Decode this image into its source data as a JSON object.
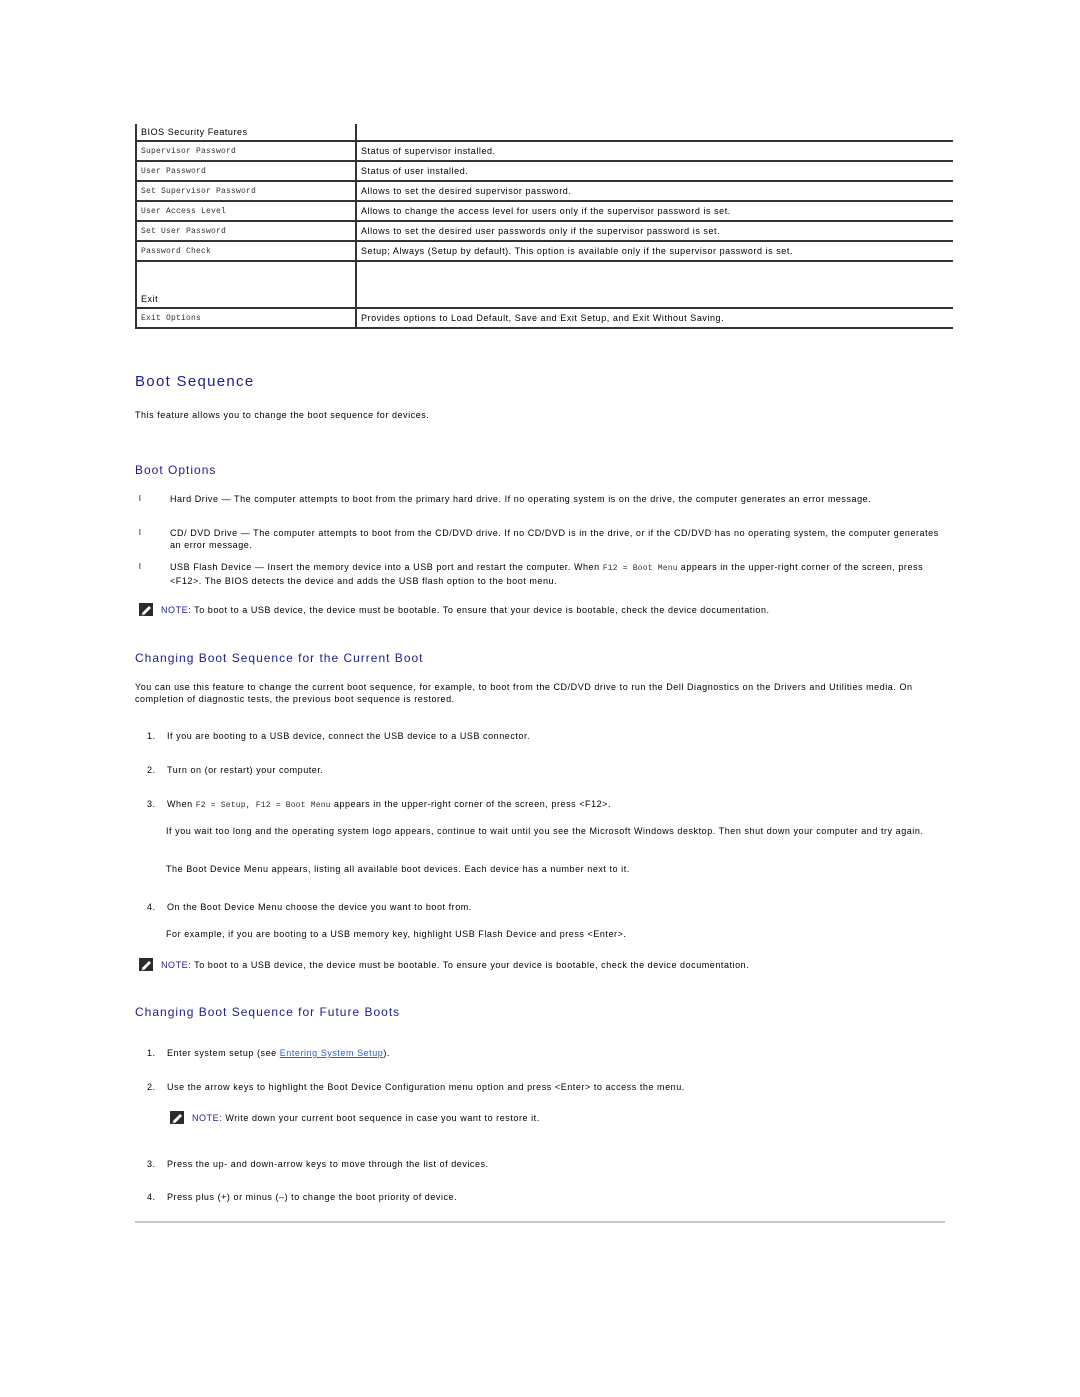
{
  "table": {
    "header": "BIOS Security Features",
    "rows": [
      {
        "option": "Supervisor Password",
        "desc": "Status of supervisor installed."
      },
      {
        "option": "User Password",
        "desc": "Status of user installed."
      },
      {
        "option": "Set Supervisor Password",
        "desc": "Allows to set the desired supervisor password."
      },
      {
        "option": "User Access Level",
        "desc": "Allows to change the access level for users only if the supervisor password is set."
      },
      {
        "option": "Set User Password",
        "desc": "Allows to set the desired user passwords only if the supervisor password is set."
      },
      {
        "option": "Password Check",
        "desc": "Setup; Always (Setup by default). This option is available only if the supervisor password is set."
      }
    ],
    "group2_header": "Exit",
    "group2_rows": [
      {
        "option": "Exit Options",
        "desc": "Provides options to Load Default, Save and Exit Setup, and Exit Without Saving."
      }
    ]
  },
  "boot_sequence": {
    "title": "Boot Sequence",
    "intro": "This feature allows you to change the boot sequence for devices."
  },
  "boot_options": {
    "title": "Boot Options",
    "bullet_mark": "l",
    "items": [
      {
        "name": "Hard Drive",
        "dash": " — ",
        "text": "The computer attempts to boot from the primary hard drive. If no operating system is on the drive, the computer generates an error message."
      },
      {
        "name": "CD/ DVD Drive",
        "dash": " — ",
        "text": "The computer attempts to boot from the CD/DVD drive. If no CD/DVD is in the drive, or if the CD/DVD has no operating system, the computer generates an error message."
      },
      {
        "name": "USB Flash Device",
        "dash": " — ",
        "text_before": "Insert the memory device into a USB port and restart the computer. When ",
        "code": "F12 = Boot Menu",
        "text_after": " appears in the upper-right corner of the screen, press <F12>. The BIOS detects the device and adds the USB flash option to the boot menu."
      }
    ],
    "note_label": "NOTE:",
    "note_text": " To boot to a USB device, the device must be bootable. To ensure that your device is bootable, check the device documentation."
  },
  "current_boot": {
    "title": "Changing Boot Sequence for the Current Boot",
    "intro": "You can use this feature to change the current boot sequence, for example, to boot from the CD/DVD drive to run the Dell Diagnostics on the Drivers and Utilities media. On completion of diagnostic tests, the previous boot sequence is restored.",
    "steps": [
      {
        "num": "1.",
        "text": "If you are booting to a USB device, connect the USB device to a USB connector."
      },
      {
        "num": "2.",
        "text": "Turn on (or restart) your computer."
      },
      {
        "num": "3.",
        "text_before": "When ",
        "code": "F2 = Setup, F12 = Boot Menu",
        "text_after": " appears in the upper-right corner of the screen, press <F12>."
      },
      {
        "num": "4.",
        "text": "On the Boot Device Menu choose the device you want to boot from."
      }
    ],
    "step3_sub1": "If you wait too long and the operating system logo appears, continue to wait until you see the Microsoft Windows desktop. Then shut down your computer and try again.",
    "step3_sub2": "The Boot Device Menu appears, listing all available boot devices. Each device has a number next to it.",
    "step4_sub": "For example, if you are booting to a USB memory key, highlight USB Flash Device and press <Enter>.",
    "note_label": "NOTE:",
    "note_text": " To boot to a USB device, the device must be bootable. To ensure your device is bootable, check the device documentation."
  },
  "future_boots": {
    "title": "Changing Boot Sequence for Future Boots",
    "steps": [
      {
        "num": "1.",
        "text_before": "Enter system setup (see ",
        "link": "Entering System Setup",
        "text_after": ")."
      },
      {
        "num": "2.",
        "text": "Use the arrow keys to highlight the Boot Device Configuration menu option and press <Enter> to access the menu."
      },
      {
        "num": "3.",
        "text": "Press the up- and down-arrow keys to move through the list of devices."
      },
      {
        "num": "4.",
        "text": "Press plus (+) or minus (–) to change the boot priority of device."
      }
    ],
    "note_label": "NOTE:",
    "note_text": " Write down your current boot sequence in case you want to restore it."
  },
  "colors": {
    "heading": "#1d1d8c",
    "link": "#2a5fc9",
    "rule": "#c8c8c8"
  }
}
